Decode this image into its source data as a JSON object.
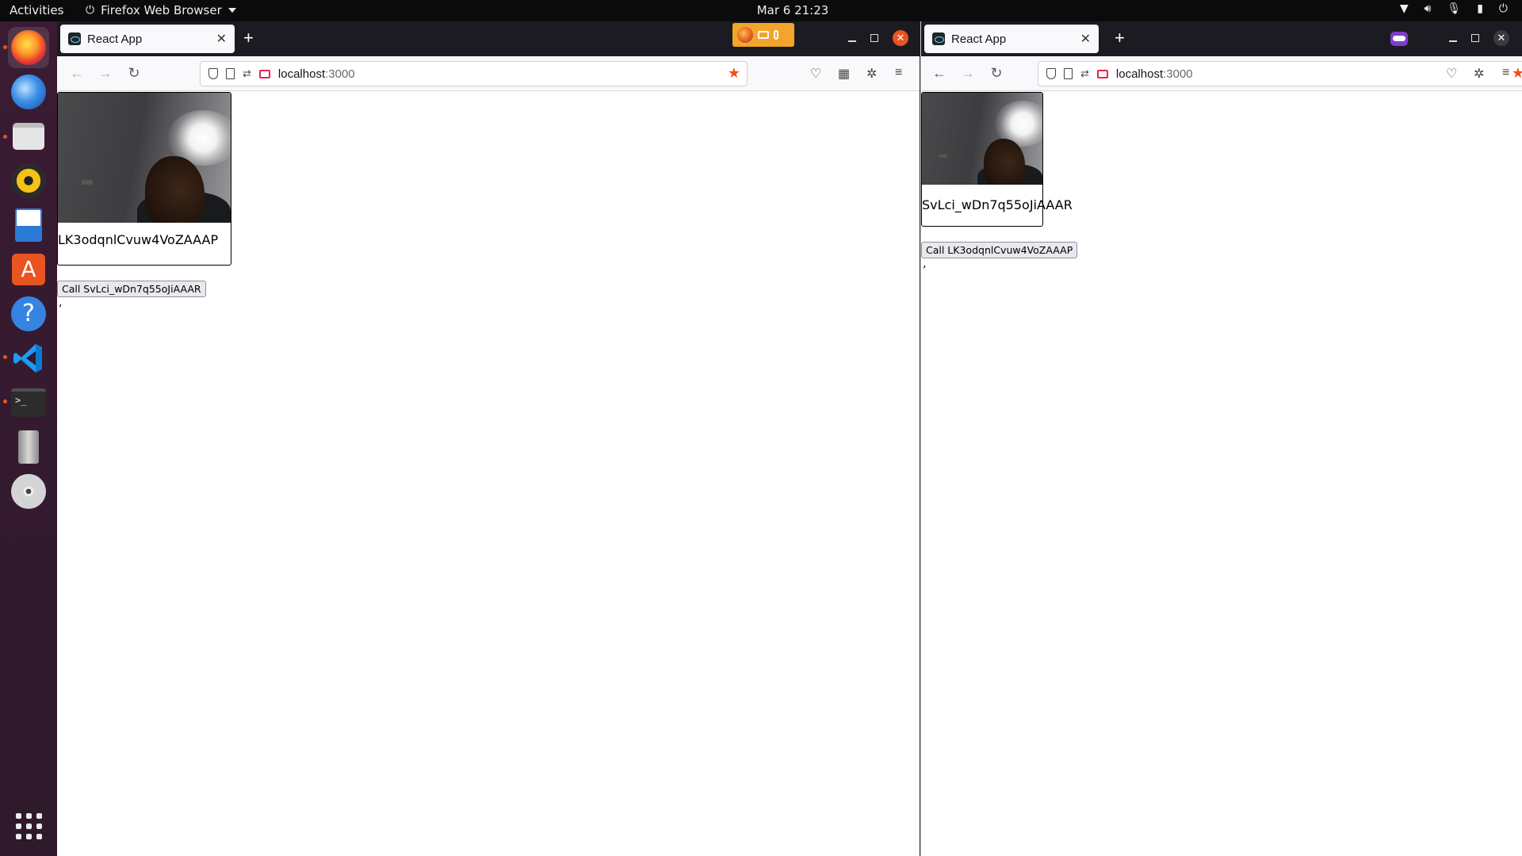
{
  "topbar": {
    "activities": "Activities",
    "app_menu": "Firefox Web Browser",
    "clock": "Mar 6  21:23",
    "tray_icons": [
      "wifi-icon",
      "volume-icon",
      "microphone-icon",
      "battery-icon",
      "power-icon"
    ]
  },
  "dock": {
    "apps": [
      {
        "name": "firefox",
        "active": true,
        "running": true
      },
      {
        "name": "thunderbird",
        "active": false,
        "running": false
      },
      {
        "name": "files",
        "active": false,
        "running": true
      },
      {
        "name": "rhythmbox",
        "active": false,
        "running": false
      },
      {
        "name": "libreoffice-writer",
        "active": false,
        "running": false
      },
      {
        "name": "ubuntu-software",
        "active": false,
        "running": false
      },
      {
        "name": "help",
        "active": false,
        "running": false
      },
      {
        "name": "vscode",
        "active": false,
        "running": true
      },
      {
        "name": "terminal",
        "active": false,
        "running": true
      },
      {
        "name": "usb-drive",
        "active": false,
        "running": false
      },
      {
        "name": "dvd-drive",
        "active": false,
        "running": false
      }
    ],
    "show_apps": "show-apps-icon"
  },
  "left_window": {
    "tab_title": "React App",
    "url_host": "localhost",
    "url_port": ":3000",
    "peer_id": "LK3odqnlCvuw4VoZAAAP",
    "call_button": "Call SvLci_wDn7q55oJiAAAR",
    "trailing_text": ","
  },
  "right_window": {
    "tab_title": "React App",
    "url_host": "localhost",
    "url_port": ":3000",
    "peer_id": "SvLci_wDn7q55oJiAAAR",
    "call_button": "Call LK3odqnlCvuw4VoZAAAP",
    "trailing_text": ","
  },
  "colors": {
    "ubuntu_orange": "#e95420",
    "bookmark_star": "#f24f1a",
    "sharing_indicator": "#f2a52a",
    "private_browsing": "#7e3ec9",
    "firefox_tabbar": "#1c1b22"
  }
}
